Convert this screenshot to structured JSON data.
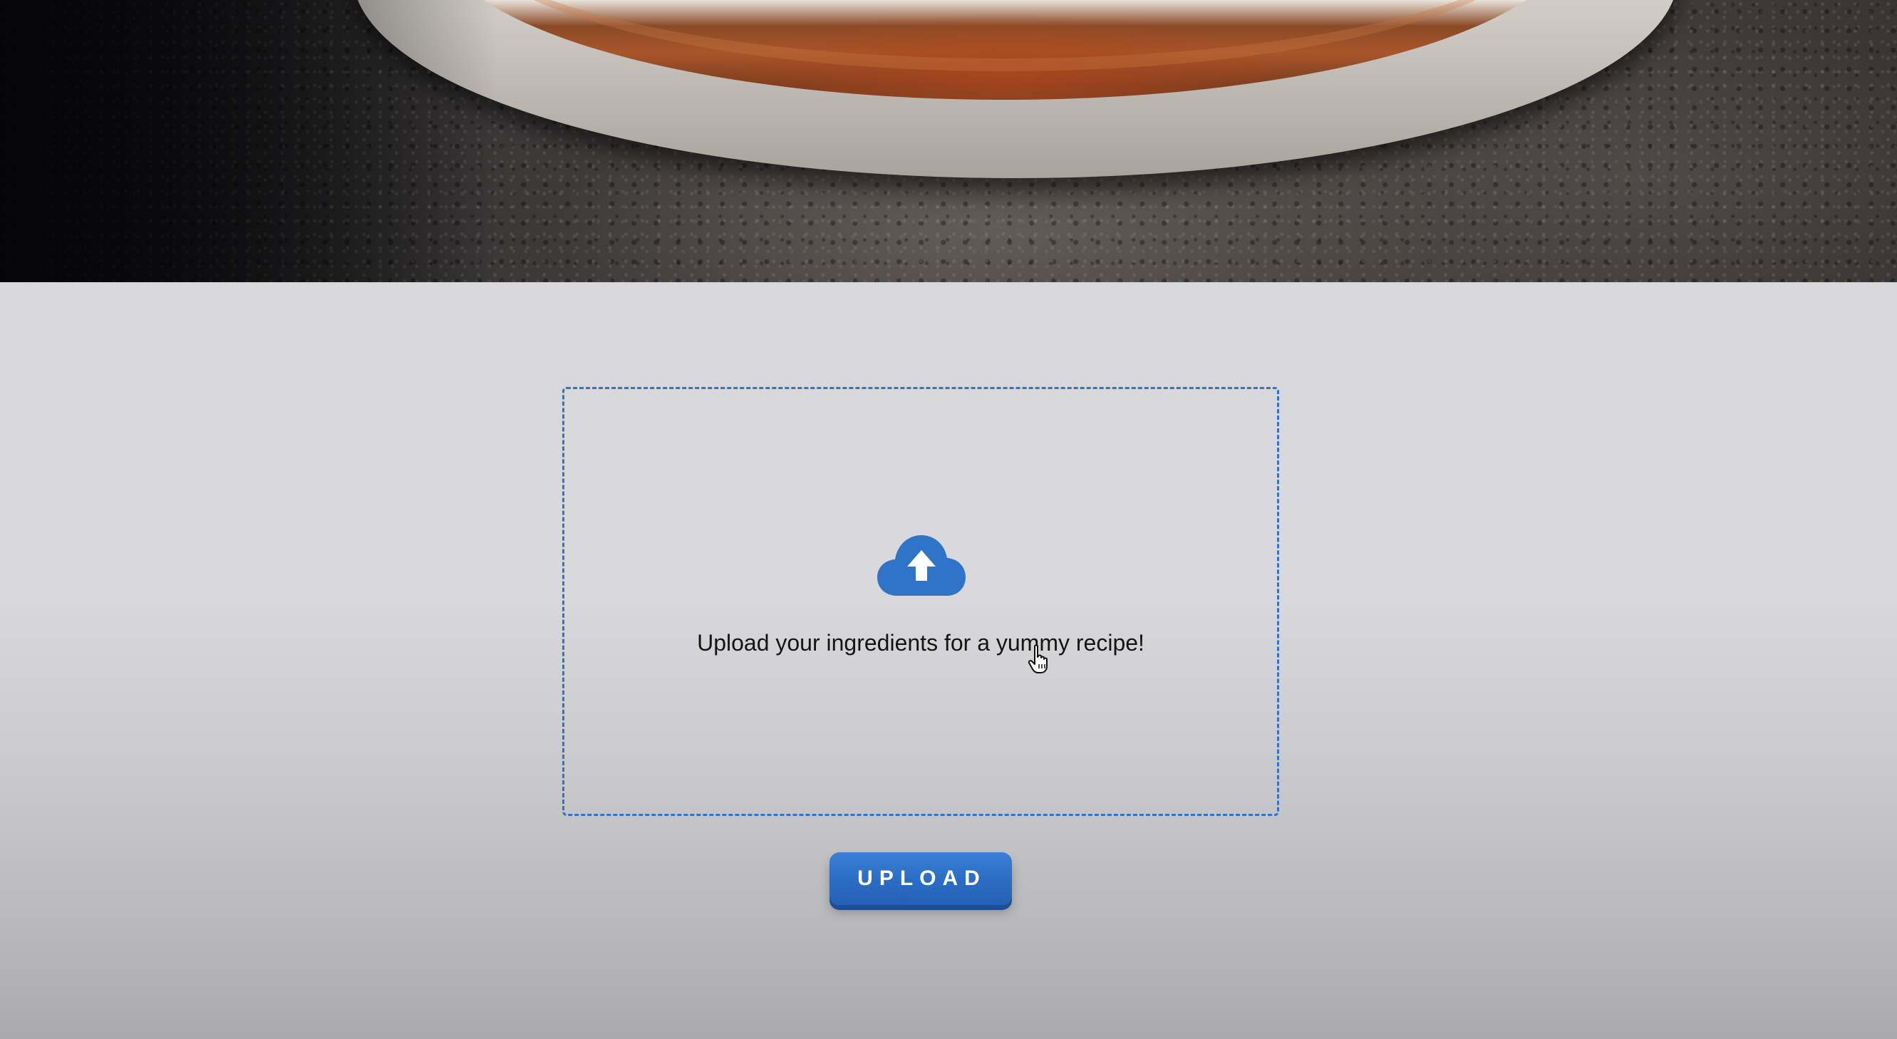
{
  "dropzone": {
    "icon": "cloud-upload-icon",
    "prompt": "Upload your ingredients for a yummy recipe!"
  },
  "upload_button": {
    "label": "UPLOAD"
  },
  "colors": {
    "accent": "#2f74c8",
    "button": "#2b6cc3",
    "text": "#141414",
    "background": "#d8d8da"
  },
  "cursor": "pointer-hand-icon"
}
